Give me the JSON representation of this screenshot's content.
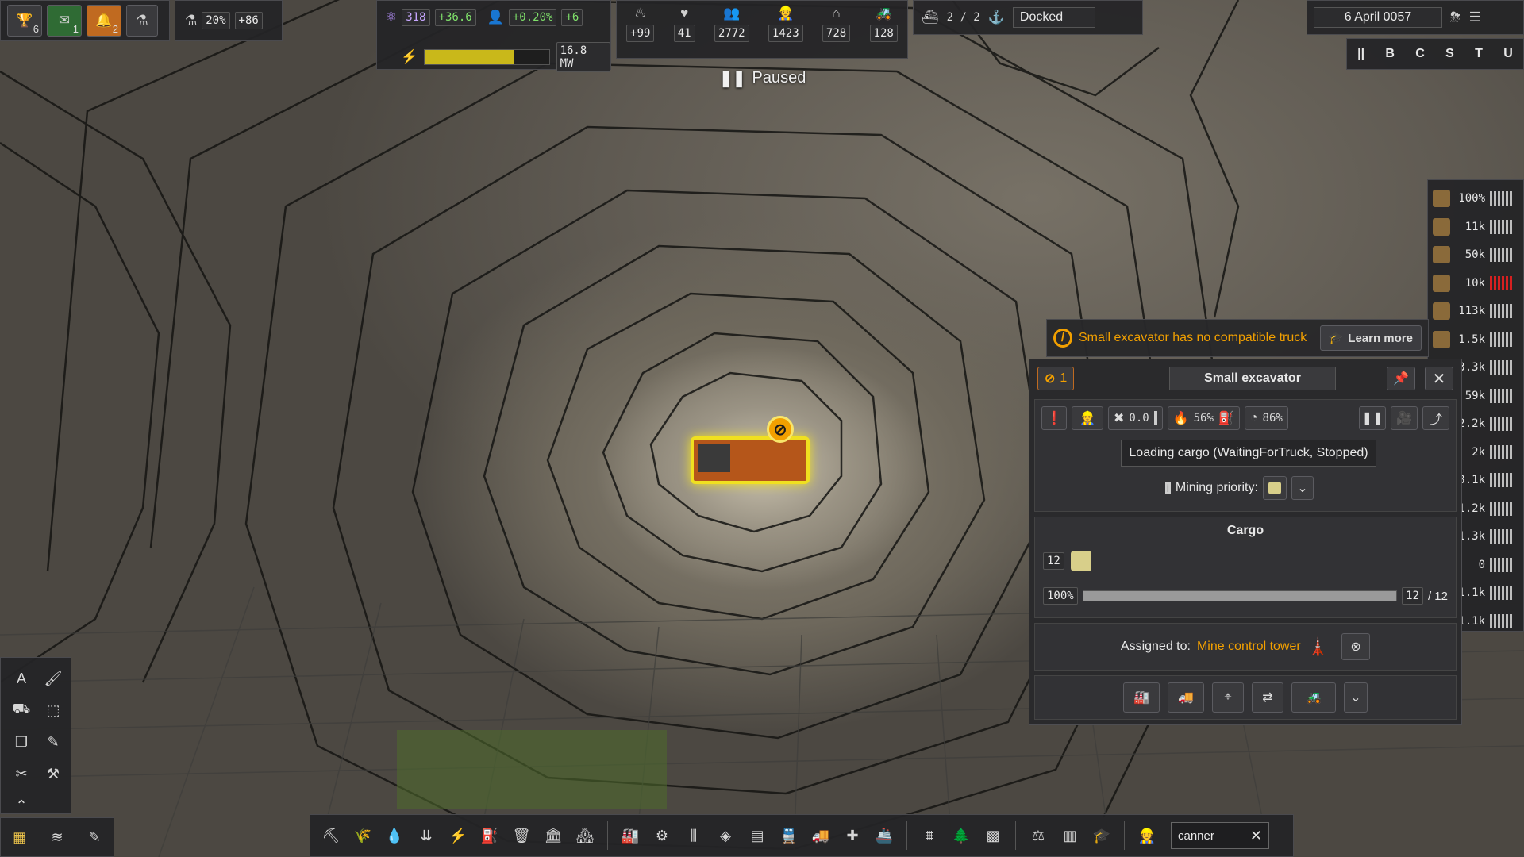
{
  "top_left": {
    "trophy_badge": "6",
    "mail_badge": "1",
    "alert_badge": "2",
    "research_percent": "20%",
    "research_gain": "+86"
  },
  "top_stats": {
    "unity": "318",
    "unity_gain": "+36.6",
    "pop_growth": "+0.20%",
    "pop_gain": "+6",
    "power": "16.8 MW",
    "power_fill": 0.72,
    "food": "+99",
    "health": "41",
    "population": "2772",
    "workers": "1423",
    "housing": "728",
    "vehicles": "128"
  },
  "ships": {
    "count": "2 / 2",
    "status": "Docked"
  },
  "date": "6 April 0057",
  "speed_keys": [
    "||",
    "B",
    "C",
    "S",
    "T",
    "U"
  ],
  "paused_label": "Paused",
  "resources": [
    {
      "icon": "maintenance-icon",
      "value": "100%",
      "warn": false
    },
    {
      "icon": "wood-icon",
      "value": "11k",
      "warn": false
    },
    {
      "icon": "rock-icon",
      "value": "50k",
      "warn": false
    },
    {
      "icon": "slab-icon",
      "value": "10k",
      "warn": true
    },
    {
      "icon": "food-icon",
      "value": "113k",
      "warn": false
    },
    {
      "icon": "resource-icon",
      "value": "1.5k",
      "warn": false
    },
    {
      "icon": "resource-icon",
      "value": "3.3k",
      "warn": false
    },
    {
      "icon": "resource-icon",
      "value": "59k",
      "warn": false
    },
    {
      "icon": "resource-icon",
      "value": "2.2k",
      "warn": false
    },
    {
      "icon": "resource-icon",
      "value": "2k",
      "warn": false
    },
    {
      "icon": "resource-icon",
      "value": "3.1k",
      "warn": false
    },
    {
      "icon": "resource-icon",
      "value": "1.2k",
      "warn": false
    },
    {
      "icon": "resource-icon",
      "value": "1.3k",
      "warn": false
    },
    {
      "icon": "resource-icon",
      "value": "0",
      "warn": false
    },
    {
      "icon": "resource-icon",
      "value": "1.1k",
      "warn": false
    },
    {
      "icon": "resource-icon",
      "value": "1.1k",
      "warn": false
    }
  ],
  "notice": {
    "text": "Small excavator has no compatible truck",
    "learn_more": "Learn more"
  },
  "inspector": {
    "issue_count": "1",
    "title": "Small excavator",
    "maintenance_value": "0.0",
    "fuel_percent": "56%",
    "efficiency_percent": "86%",
    "status": "Loading cargo (WaitingForTruck, Stopped)",
    "mining_priority_label": "Mining priority:",
    "cargo_header": "Cargo",
    "cargo_qty": "12",
    "cargo_fill_label": "100%",
    "cargo_fill": 1.0,
    "cargo_current": "12",
    "cargo_capacity": "/ 12",
    "assigned_label": "Assigned to:",
    "assigned_target": "Mine control tower"
  },
  "search": {
    "value": "canner"
  }
}
